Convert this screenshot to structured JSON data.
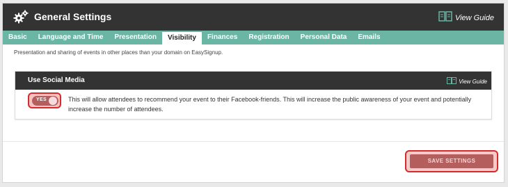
{
  "header": {
    "title": "General Settings",
    "guide_label": "View Guide"
  },
  "tabs": [
    {
      "label": "Basic",
      "active": false
    },
    {
      "label": "Language and Time",
      "active": false
    },
    {
      "label": "Presentation",
      "active": false
    },
    {
      "label": "Visibility",
      "active": true
    },
    {
      "label": "Finances",
      "active": false
    },
    {
      "label": "Registration",
      "active": false
    },
    {
      "label": "Personal Data",
      "active": false
    },
    {
      "label": "Emails",
      "active": false
    }
  ],
  "description": "Presentation and sharing of events in other places than your domain on EasySignup.",
  "social_media": {
    "title": "Use Social Media",
    "guide_label": "View Guide",
    "toggle_label": "YES",
    "toggle_on": true,
    "text": "This will allow attendees to recommend your event to their Facebook-friends. This will increase the public awareness of your event and potentially increase the number of attendees."
  },
  "footer": {
    "save_label": "SAVE SETTINGS"
  },
  "colors": {
    "header_bg": "#333333",
    "tab_bar": "#6ab5a3",
    "highlight": "#d52b2b",
    "button": "#b55e5e"
  }
}
